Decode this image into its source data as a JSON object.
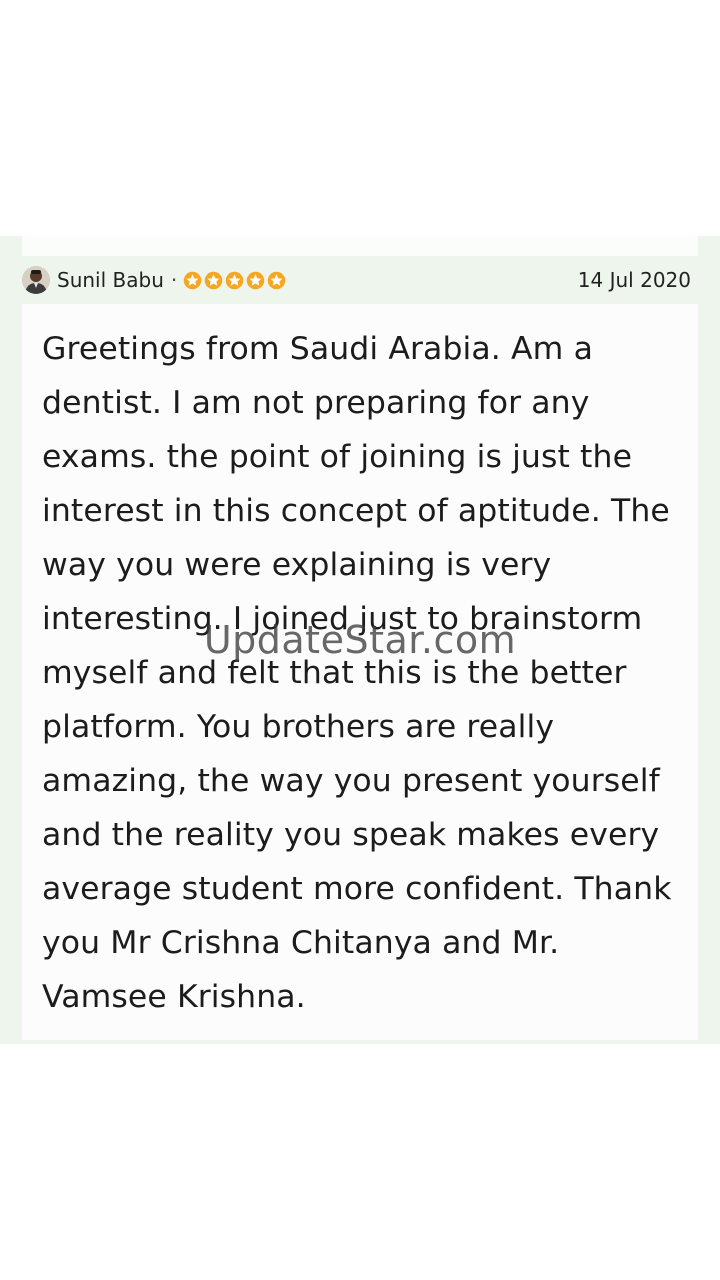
{
  "review": {
    "reviewer_name": "Sunil Babu",
    "separator": "·",
    "rating": 5,
    "rating_max": 5,
    "star_color": "#f5a623",
    "date": "14 Jul 2020",
    "text": "Greetings from Saudi Arabia. Am a dentist. I am not preparing for any exams. the point of joining is just the interest in this concept of aptitude. The way you were explaining is very interesting. I joined just to brainstorm myself and felt that this is the better platform. You brothers are really amazing, the way you present yourself and the reality you speak makes every average student more confident. Thank you Mr Crishna Chitanya and Mr. Vamsee Krishna."
  },
  "watermark": {
    "text": "UpdateStar.com"
  },
  "colors": {
    "card_background": "#eef5ec",
    "body_background": "#fcfcfc"
  }
}
